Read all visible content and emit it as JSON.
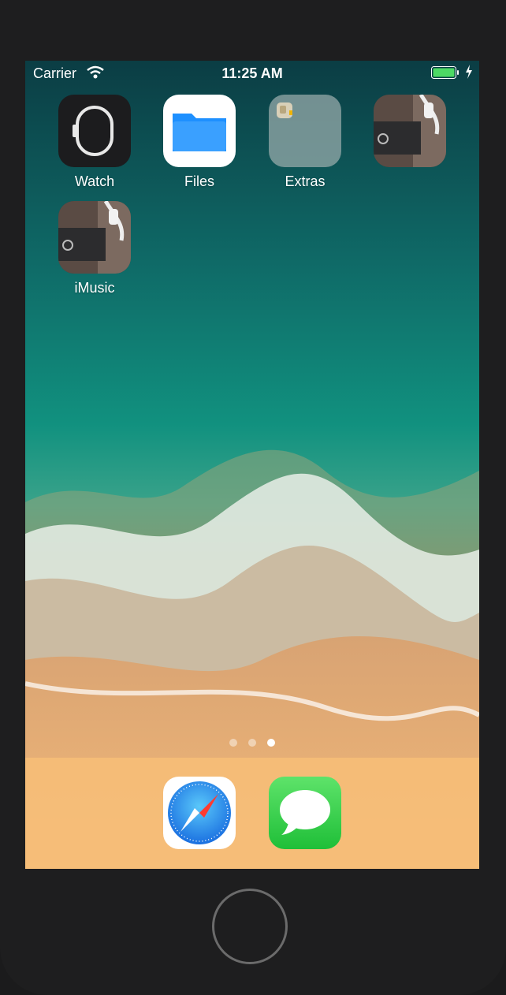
{
  "status_bar": {
    "carrier": "Carrier",
    "time": "11:25 AM",
    "battery_color": "#4cd964"
  },
  "home_screen": {
    "apps": [
      {
        "label": "Watch",
        "icon": "watch-icon"
      },
      {
        "label": "Files",
        "icon": "folder-icon"
      },
      {
        "label": "Extras",
        "icon": "folder-group-icon"
      },
      {
        "label": "",
        "icon": "music-photo-icon"
      },
      {
        "label": "iMusic",
        "icon": "music-photo-icon"
      }
    ],
    "page_count": 3,
    "current_page": 3
  },
  "dock": {
    "apps": [
      {
        "name": "Safari",
        "icon": "compass-icon"
      },
      {
        "name": "Messages",
        "icon": "speech-bubble-icon"
      }
    ]
  },
  "colors": {
    "files_blue": "#1e90ff",
    "messages_green": "#34c759",
    "safari_blue": "#1a8cff"
  }
}
